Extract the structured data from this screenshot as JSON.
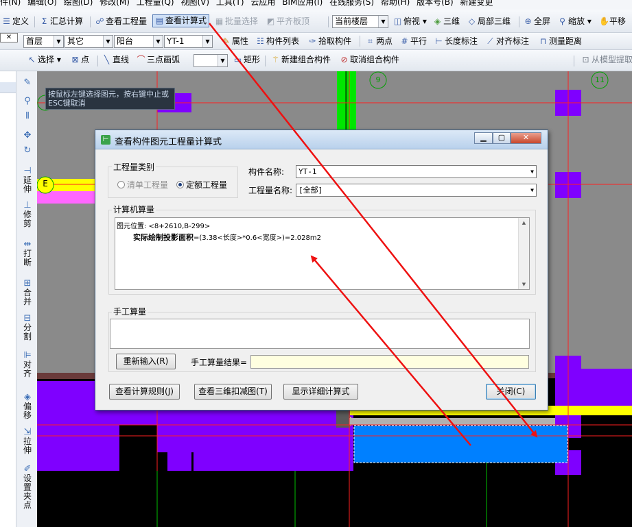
{
  "menu": [
    "件(N)",
    "编辑(O)",
    "绘图(D)",
    "修改(M)",
    "工程量(Q)",
    "视图(V)",
    "工具(T)",
    "云应用",
    "BIM应用(I)",
    "在线服务(S)",
    "帮助(H)",
    "版本号(B)",
    "新建变更"
  ],
  "toolbar1": {
    "define": "定义",
    "sum": "汇总计算",
    "view_qty": "查看工程量",
    "view_formula": "查看计算式",
    "batch_select": "批量选择",
    "align_slab": "平齐板顶",
    "floor_combo": "当前楼层",
    "top_view": "俯视",
    "view3d": "三维",
    "local3d": "局部三维",
    "fullscreen": "全屏",
    "zoom": "缩放",
    "pan": "平移"
  },
  "toolbar2": {
    "floor": "首层",
    "category": "其它",
    "type": "阳台",
    "member": "YT-1",
    "props": "属性",
    "member_list": "构件列表",
    "pick_member": "拾取构件",
    "two_points": "两点",
    "parallel": "平行",
    "dim_line": "长度标注",
    "align_dim": "对齐标注",
    "measure": "测量距离"
  },
  "toolbar3": {
    "select": "选择",
    "point": "点",
    "line": "直线",
    "arc3": "三点画弧",
    "rect": "矩形",
    "new_group": "新建组合构件",
    "cancel_group": "取消组合构件",
    "extract": "从模型提取"
  },
  "left_tools": [
    {
      "icon": "✎",
      "label": ""
    },
    {
      "icon": "⚲",
      "label": ""
    },
    {
      "icon": "⫴",
      "label": ""
    },
    {
      "icon": "✥",
      "label": ""
    },
    {
      "icon": "↻",
      "label": ""
    },
    {
      "icon": "⊣",
      "label": "延伸"
    },
    {
      "icon": "⊥",
      "label": "修剪"
    },
    {
      "icon": "⇹",
      "label": "打断"
    },
    {
      "icon": "⊞",
      "label": "合并"
    },
    {
      "icon": "⊟",
      "label": "分割"
    },
    {
      "icon": "⊫",
      "label": "对齐"
    },
    {
      "icon": "◈",
      "label": "偏移"
    },
    {
      "icon": "⇲",
      "label": "拉伸"
    },
    {
      "icon": "✐",
      "label": "设置夹点"
    }
  ],
  "canvas": {
    "tooltip": "按鼠标左键选择图元，按右键中止或ESC键取消",
    "axis_e": "E",
    "axis_9": "9",
    "axis_11": "11"
  },
  "dialog": {
    "title": "查看构件图元工程量计算式",
    "qty_type_label": "工程量类别",
    "radio_list": "清单工程量",
    "radio_quota": "定额工程量",
    "member_name_label": "构件名称:",
    "member_name_value": "YT-1",
    "qty_name_label": "工程量名称:",
    "qty_name_value": "[全部]",
    "computer_calc_label": "计算机算量",
    "calc_line1": "图元位置: <8+2610,B-299>",
    "calc_line2_bold": "实际绘制投影面积",
    "calc_line2_rest": "=(3.38<长度>*0.6<宽度>)=2.028m2",
    "manual_calc_label": "手工算量",
    "reinput_button": "重新输入(R)",
    "manual_result_label": "手工算量结果=",
    "view_rules_button": "查看计算规则(J)",
    "view_3d_button": "查看三维扣减图(T)",
    "show_detail_button": "显示详细计算式",
    "close_button": "关闭(C)"
  },
  "colors": {
    "purple": "#7f00ff",
    "blue_selected": "#0080ff",
    "yellow": "#ffff00",
    "green": "#00e600",
    "red_arrow": "#ee1111",
    "pink": "#ff66ff"
  }
}
